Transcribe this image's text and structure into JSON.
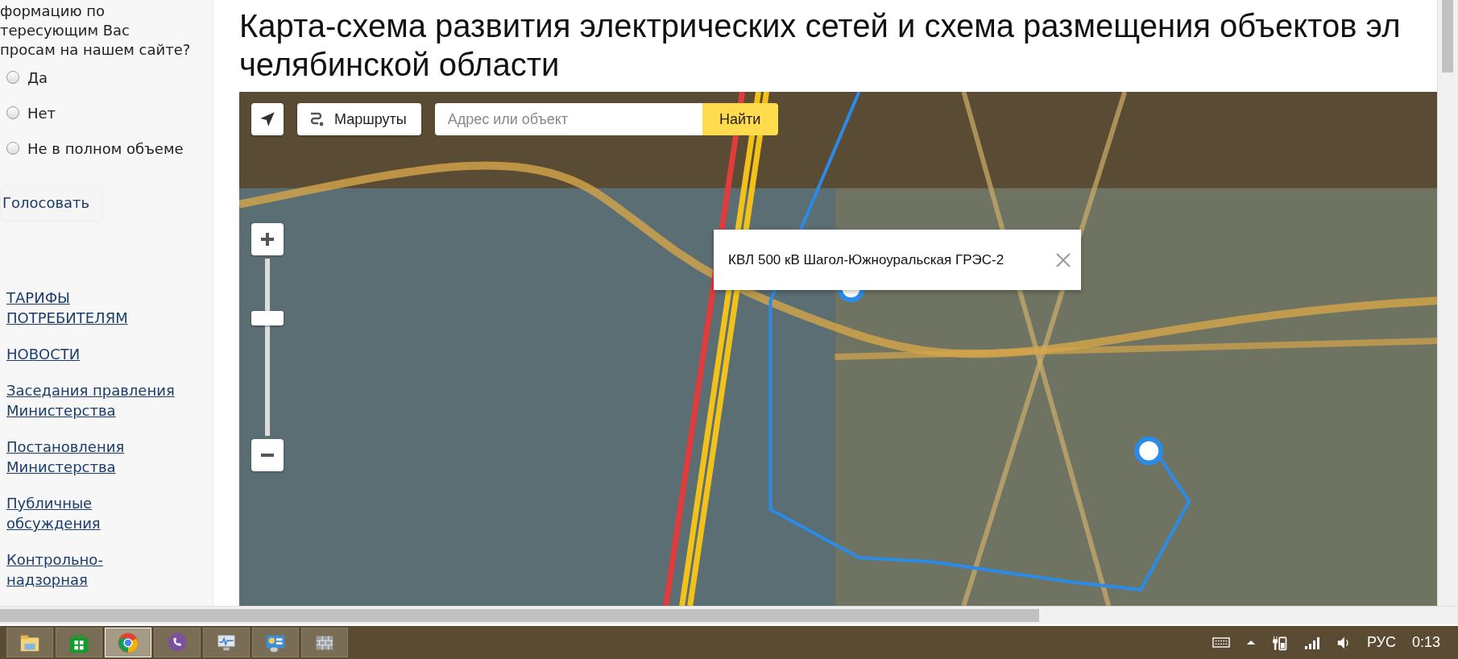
{
  "sidebar": {
    "poll_question_lines": [
      "формацию по",
      "тересующим Вас",
      "просам на нашем сайте?"
    ],
    "poll_options": [
      {
        "label": "Да",
        "selected": false
      },
      {
        "label": "Нет",
        "selected": false
      },
      {
        "label": "Не в полном объеме",
        "selected": false
      }
    ],
    "vote_button": "Голосовать",
    "links": [
      "ТАРИФЫ ПОТРЕБИТЕЛЯМ",
      "НОВОСТИ",
      "Заседания правления Министерства",
      "Постановления Министерства",
      "Публичные обсуждения",
      "Контрольно-надзорная"
    ]
  },
  "page": {
    "title_lines": [
      "Карта-схема развития электрических сетей и схема размещения объектов эл",
      "челябинской области"
    ]
  },
  "map": {
    "routes_button": "Маршруты",
    "search_placeholder": "Адрес или объект",
    "find_button": "Найти",
    "zoom": {
      "level": 0.68
    },
    "popup": "КВЛ 500 кВ Шагол-Южноуральская ГРЭС-2"
  },
  "taskbar": {
    "apps": [
      {
        "kind": "folder",
        "selected": false
      },
      {
        "kind": "store",
        "selected": false
      },
      {
        "kind": "browser",
        "selected": true
      },
      {
        "kind": "phone",
        "selected": false
      },
      {
        "kind": "monitor",
        "selected": false
      },
      {
        "kind": "panel",
        "selected": false
      },
      {
        "kind": "wall",
        "selected": false
      }
    ],
    "language": "РУС",
    "time": "0:13"
  }
}
